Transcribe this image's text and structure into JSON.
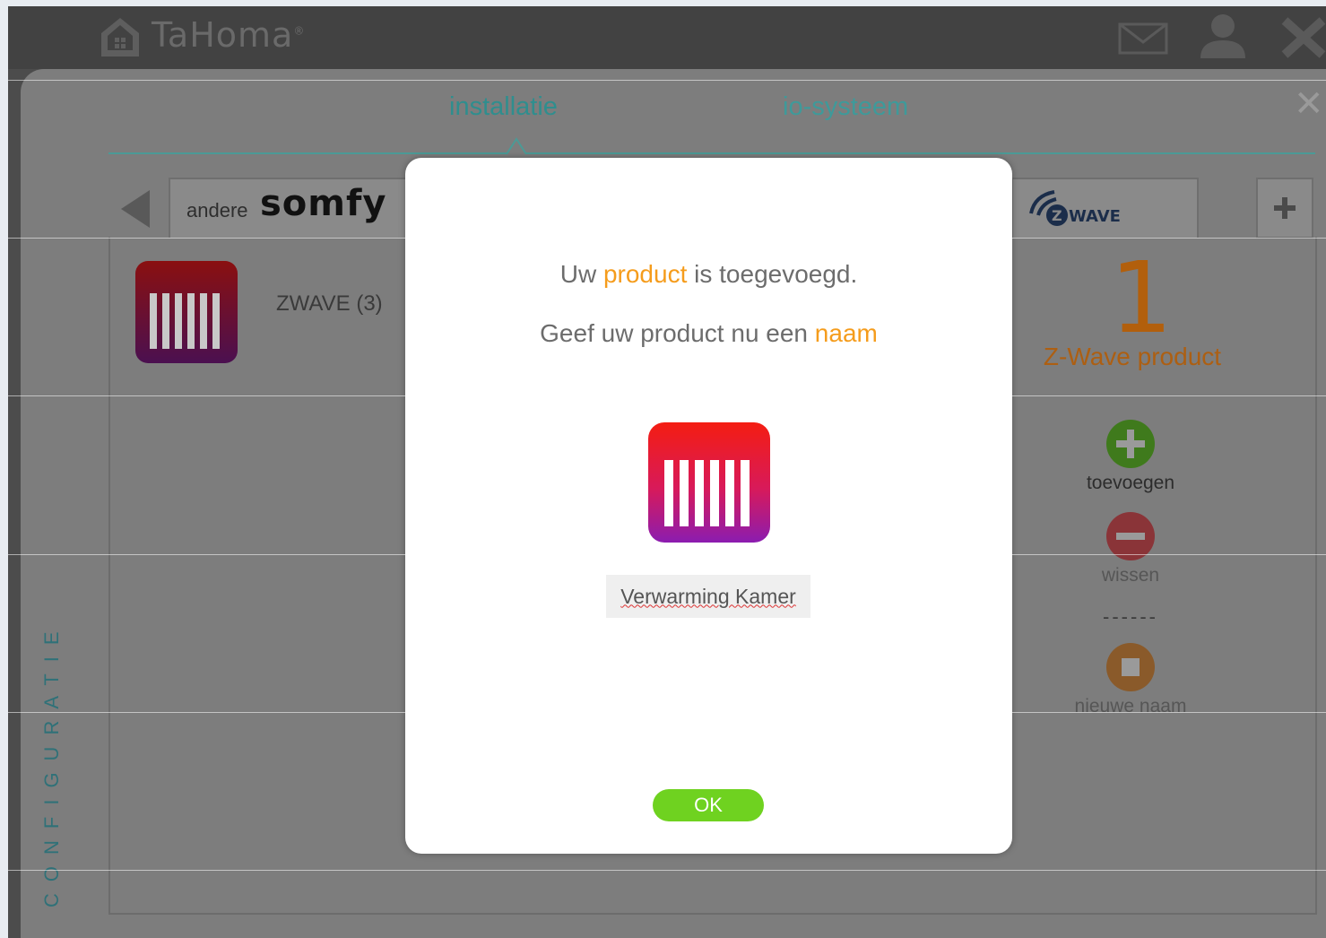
{
  "app": {
    "brand": "TaHoma",
    "registered": "®"
  },
  "tabs": [
    {
      "label": "installatie",
      "active": true
    },
    {
      "label": "io-systeem",
      "active": false
    }
  ],
  "brands": {
    "andere": "andere",
    "somfy": "somfy",
    "zwave": "WAVE"
  },
  "product_list": {
    "item_label": "ZWAVE (3)"
  },
  "summary": {
    "count": "1",
    "label": "Z-Wave product"
  },
  "actions": {
    "add": "toevoegen",
    "delete": "wissen",
    "separator": "------",
    "rename": "nieuwe naam"
  },
  "sidebar": {
    "vertical_label": "CONFIGURATIE"
  },
  "dialog": {
    "line1_pre": "Uw ",
    "line1_hl": "product",
    "line1_post": " is toegevoegd.",
    "line2_pre": "Geef uw product nu een ",
    "line2_hl": "naam",
    "name_value": "Verwarming Kamer",
    "ok_label": "OK"
  },
  "colors": {
    "accent_orange": "#f59c1c",
    "ok_green": "#6fd220",
    "teal": "#2f8e8e",
    "add_green": "#6cbf2a",
    "delete_red": "#e3454d",
    "rename_orange": "#f0a040"
  }
}
